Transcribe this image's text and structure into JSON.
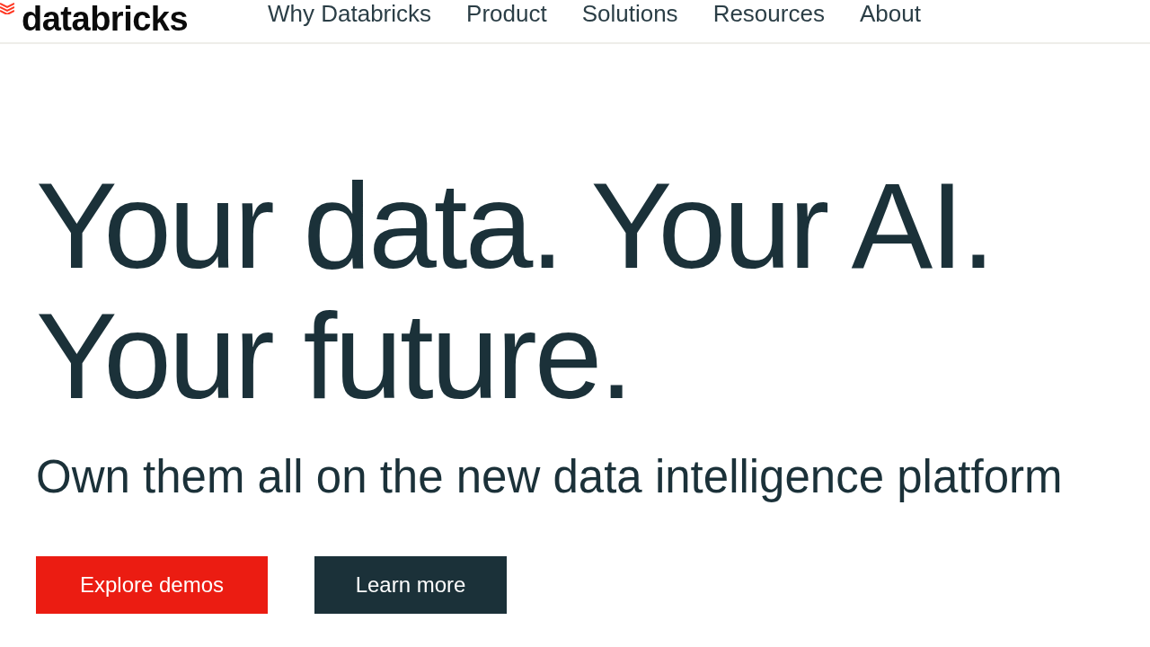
{
  "header": {
    "logo": {
      "text": "databricks"
    },
    "nav": [
      "Why Databricks",
      "Product",
      "Solutions",
      "Resources",
      "About"
    ]
  },
  "hero": {
    "headline": "Your data. Your AI. Your future.",
    "subheadline": "Own them all on the new data intelligence platform",
    "buttons": [
      {
        "label": "Explore demos",
        "kind": "primary"
      },
      {
        "label": "Learn more",
        "kind": "secondary"
      }
    ]
  }
}
